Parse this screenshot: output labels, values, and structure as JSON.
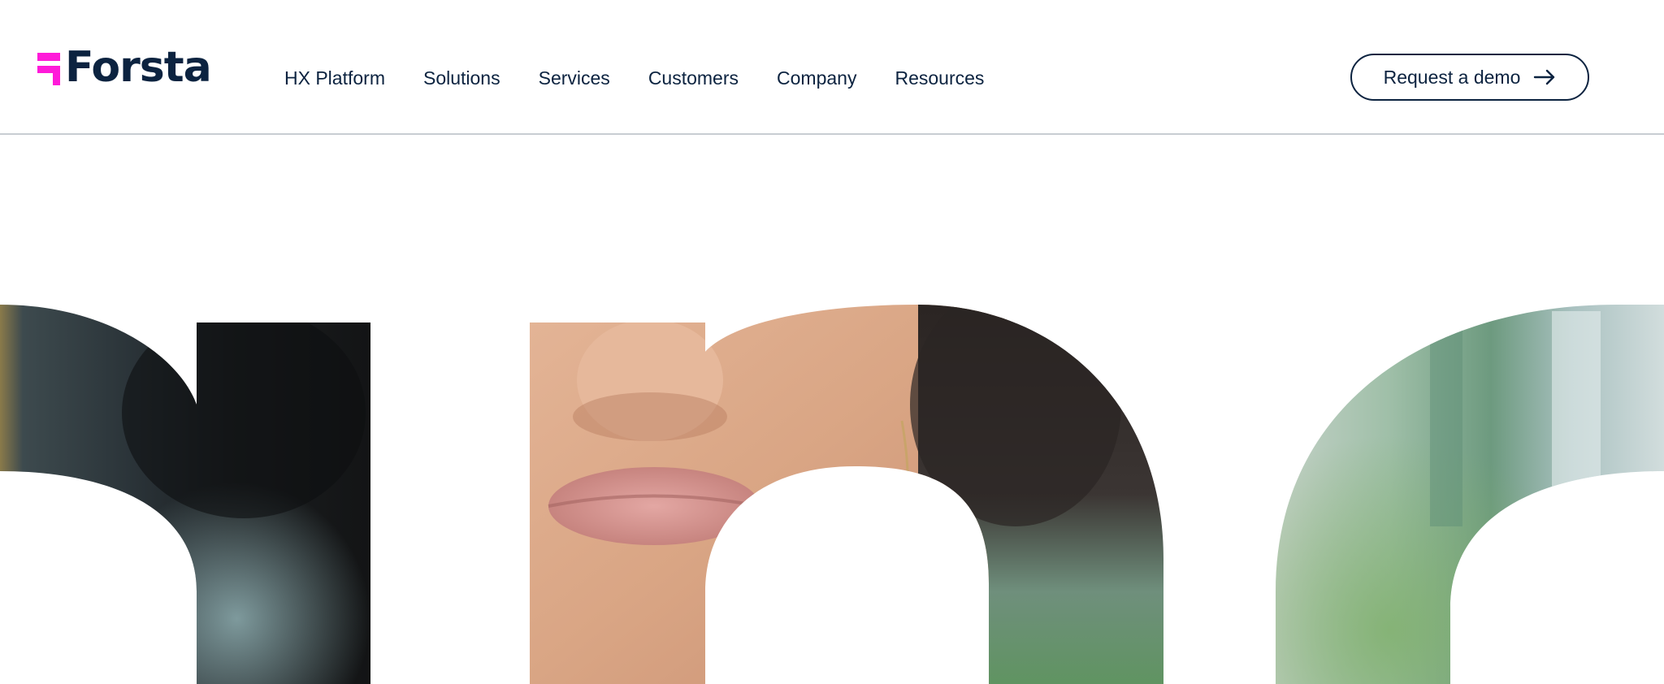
{
  "brand": {
    "name": "Forsta",
    "accent_color": "#ff1ad9",
    "text_color": "#0c2340"
  },
  "nav": {
    "items": [
      {
        "label": "HX Platform"
      },
      {
        "label": "Solutions"
      },
      {
        "label": "Services"
      },
      {
        "label": "Customers"
      },
      {
        "label": "Company"
      },
      {
        "label": "Resources"
      }
    ]
  },
  "cta": {
    "label": "Request a demo",
    "icon": "arrow-right-icon"
  },
  "hero": {
    "image": "letterform-photo-collage",
    "colors": {
      "hair_dark": "#1b1b1c",
      "skin": "#dba887",
      "lips": "#c98a86",
      "foliage": "#7fa98c",
      "blur_bg": "#b9c9c2"
    }
  }
}
